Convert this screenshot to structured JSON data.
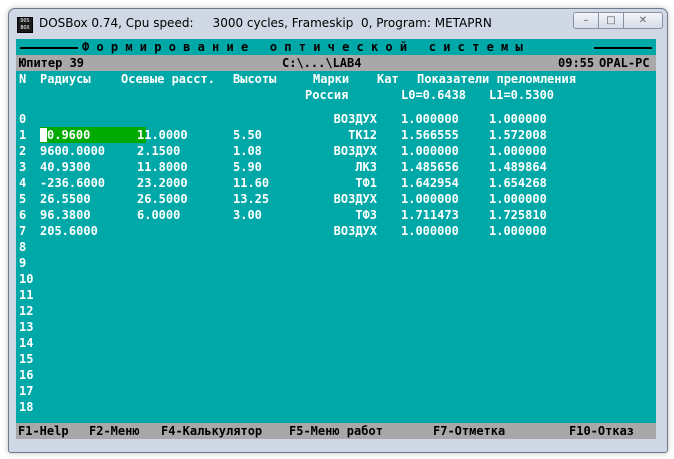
{
  "window": {
    "title": "DOSBox 0.74, Cpu speed:     3000 cycles, Frameskip  0, Program: METAPRN",
    "icon_label": "DOS BOX",
    "buttons": {
      "minimize": "–",
      "maximize": "□",
      "close": "✕"
    }
  },
  "header": {
    "title": "Ф о р м и р о в а н и е   о п т и ч е с к о й   с и с т е м ы",
    "program": "Юпитер 39",
    "path": "C:\\...\\LAB4",
    "time": "09:55",
    "host": "OPAL-PC"
  },
  "columns": {
    "n": "N",
    "radii": "Радиусы",
    "axial": "Осевые расст.",
    "heights": "Высоты",
    "marks": "Марки",
    "marks_sub": "Россия",
    "cat": "Кат",
    "indices": "Показатели преломления",
    "l0": "L0=0.6438",
    "l1": "L1=0.5300"
  },
  "rows": [
    {
      "n": "0",
      "radius": "",
      "axial": "",
      "height": "",
      "mark": "ВОЗДУХ",
      "n0": "1.000000",
      "n1": "1.000000"
    },
    {
      "n": "1",
      "radius": "0.9600",
      "axial": "11.0000",
      "height": "5.50",
      "mark": "ТК12",
      "n0": "1.566555",
      "n1": "1.572008"
    },
    {
      "n": "2",
      "radius": "9600.0000",
      "axial": "2.1500",
      "height": "1.08",
      "mark": "ВОЗДУХ",
      "n0": "1.000000",
      "n1": "1.000000"
    },
    {
      "n": "3",
      "radius": "40.9300",
      "axial": "11.8000",
      "height": "5.90",
      "mark": "ЛК3",
      "n0": "1.485656",
      "n1": "1.489864"
    },
    {
      "n": "4",
      "radius": "-236.6000",
      "axial": "23.2000",
      "height": "11.60",
      "mark": "ТФ1",
      "n0": "1.642954",
      "n1": "1.654268"
    },
    {
      "n": "5",
      "radius": "26.5500",
      "axial": "26.5000",
      "height": "13.25",
      "mark": "ВОЗДУХ",
      "n0": "1.000000",
      "n1": "1.000000"
    },
    {
      "n": "6",
      "radius": "96.3800",
      "axial": "6.0000",
      "height": "3.00",
      "mark": "ТФ3",
      "n0": "1.711473",
      "n1": "1.725810"
    },
    {
      "n": "7",
      "radius": "205.6000",
      "axial": "",
      "height": "",
      "mark": "ВОЗДУХ",
      "n0": "1.000000",
      "n1": "1.000000"
    },
    {
      "n": "8",
      "radius": "",
      "axial": "",
      "height": "",
      "mark": "",
      "n0": "",
      "n1": ""
    },
    {
      "n": "9",
      "radius": "",
      "axial": "",
      "height": "",
      "mark": "",
      "n0": "",
      "n1": ""
    },
    {
      "n": "10",
      "radius": "",
      "axial": "",
      "height": "",
      "mark": "",
      "n0": "",
      "n1": ""
    },
    {
      "n": "11",
      "radius": "",
      "axial": "",
      "height": "",
      "mark": "",
      "n0": "",
      "n1": ""
    },
    {
      "n": "12",
      "radius": "",
      "axial": "",
      "height": "",
      "mark": "",
      "n0": "",
      "n1": ""
    },
    {
      "n": "13",
      "radius": "",
      "axial": "",
      "height": "",
      "mark": "",
      "n0": "",
      "n1": ""
    },
    {
      "n": "14",
      "radius": "",
      "axial": "",
      "height": "",
      "mark": "",
      "n0": "",
      "n1": ""
    },
    {
      "n": "15",
      "radius": "",
      "axial": "",
      "height": "",
      "mark": "",
      "n0": "",
      "n1": ""
    },
    {
      "n": "16",
      "radius": "",
      "axial": "",
      "height": "",
      "mark": "",
      "n0": "",
      "n1": ""
    },
    {
      "n": "17",
      "radius": "",
      "axial": "",
      "height": "",
      "mark": "",
      "n0": "",
      "n1": ""
    },
    {
      "n": "18",
      "radius": "",
      "axial": "",
      "height": "",
      "mark": "",
      "n0": "",
      "n1": ""
    }
  ],
  "fkeys": [
    {
      "key": "F1-Help"
    },
    {
      "key": "F2-Меню"
    },
    {
      "key": "F4-Калькулятор"
    },
    {
      "key": "F5-Меню работ"
    },
    {
      "key": "F7-Отметка"
    },
    {
      "key": "F10-Отказ"
    }
  ],
  "colors": {
    "dos_bg": "#00a8a8",
    "bar_bg": "#a8a8a8",
    "selection": "#00aa00"
  }
}
